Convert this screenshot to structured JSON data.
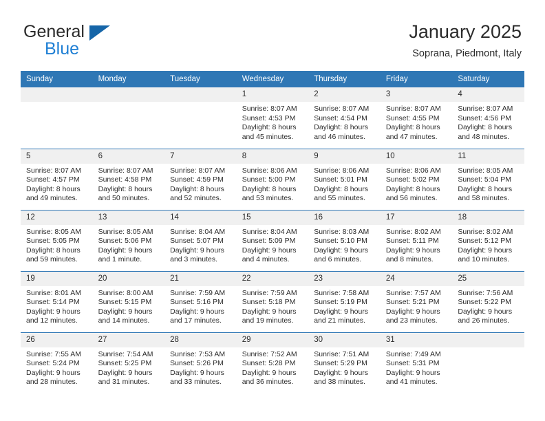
{
  "brand": {
    "word_one": "General",
    "word_two": "Blue",
    "logo_icon": "triangle-logo-icon"
  },
  "header": {
    "title": "January 2025",
    "subtitle": "Soprana, Piedmont, Italy"
  },
  "colors": {
    "header_blue": "#2f77b5",
    "brand_blue": "#1f7fd4",
    "daynum_band": "#f0f0f0",
    "text": "#2b2b2b"
  },
  "weekday_headers": [
    "Sunday",
    "Monday",
    "Tuesday",
    "Wednesday",
    "Thursday",
    "Friday",
    "Saturday"
  ],
  "weeks": [
    [
      {
        "day": "",
        "empty": true,
        "sunrise": "",
        "sunset": "",
        "daylight_line1": "",
        "daylight_line2": ""
      },
      {
        "day": "",
        "empty": true,
        "sunrise": "",
        "sunset": "",
        "daylight_line1": "",
        "daylight_line2": ""
      },
      {
        "day": "",
        "empty": true,
        "sunrise": "",
        "sunset": "",
        "daylight_line1": "",
        "daylight_line2": ""
      },
      {
        "day": "1",
        "empty": false,
        "sunrise": "Sunrise: 8:07 AM",
        "sunset": "Sunset: 4:53 PM",
        "daylight_line1": "Daylight: 8 hours",
        "daylight_line2": "and 45 minutes."
      },
      {
        "day": "2",
        "empty": false,
        "sunrise": "Sunrise: 8:07 AM",
        "sunset": "Sunset: 4:54 PM",
        "daylight_line1": "Daylight: 8 hours",
        "daylight_line2": "and 46 minutes."
      },
      {
        "day": "3",
        "empty": false,
        "sunrise": "Sunrise: 8:07 AM",
        "sunset": "Sunset: 4:55 PM",
        "daylight_line1": "Daylight: 8 hours",
        "daylight_line2": "and 47 minutes."
      },
      {
        "day": "4",
        "empty": false,
        "sunrise": "Sunrise: 8:07 AM",
        "sunset": "Sunset: 4:56 PM",
        "daylight_line1": "Daylight: 8 hours",
        "daylight_line2": "and 48 minutes."
      }
    ],
    [
      {
        "day": "5",
        "empty": false,
        "sunrise": "Sunrise: 8:07 AM",
        "sunset": "Sunset: 4:57 PM",
        "daylight_line1": "Daylight: 8 hours",
        "daylight_line2": "and 49 minutes."
      },
      {
        "day": "6",
        "empty": false,
        "sunrise": "Sunrise: 8:07 AM",
        "sunset": "Sunset: 4:58 PM",
        "daylight_line1": "Daylight: 8 hours",
        "daylight_line2": "and 50 minutes."
      },
      {
        "day": "7",
        "empty": false,
        "sunrise": "Sunrise: 8:07 AM",
        "sunset": "Sunset: 4:59 PM",
        "daylight_line1": "Daylight: 8 hours",
        "daylight_line2": "and 52 minutes."
      },
      {
        "day": "8",
        "empty": false,
        "sunrise": "Sunrise: 8:06 AM",
        "sunset": "Sunset: 5:00 PM",
        "daylight_line1": "Daylight: 8 hours",
        "daylight_line2": "and 53 minutes."
      },
      {
        "day": "9",
        "empty": false,
        "sunrise": "Sunrise: 8:06 AM",
        "sunset": "Sunset: 5:01 PM",
        "daylight_line1": "Daylight: 8 hours",
        "daylight_line2": "and 55 minutes."
      },
      {
        "day": "10",
        "empty": false,
        "sunrise": "Sunrise: 8:06 AM",
        "sunset": "Sunset: 5:02 PM",
        "daylight_line1": "Daylight: 8 hours",
        "daylight_line2": "and 56 minutes."
      },
      {
        "day": "11",
        "empty": false,
        "sunrise": "Sunrise: 8:05 AM",
        "sunset": "Sunset: 5:04 PM",
        "daylight_line1": "Daylight: 8 hours",
        "daylight_line2": "and 58 minutes."
      }
    ],
    [
      {
        "day": "12",
        "empty": false,
        "sunrise": "Sunrise: 8:05 AM",
        "sunset": "Sunset: 5:05 PM",
        "daylight_line1": "Daylight: 8 hours",
        "daylight_line2": "and 59 minutes."
      },
      {
        "day": "13",
        "empty": false,
        "sunrise": "Sunrise: 8:05 AM",
        "sunset": "Sunset: 5:06 PM",
        "daylight_line1": "Daylight: 9 hours",
        "daylight_line2": "and 1 minute."
      },
      {
        "day": "14",
        "empty": false,
        "sunrise": "Sunrise: 8:04 AM",
        "sunset": "Sunset: 5:07 PM",
        "daylight_line1": "Daylight: 9 hours",
        "daylight_line2": "and 3 minutes."
      },
      {
        "day": "15",
        "empty": false,
        "sunrise": "Sunrise: 8:04 AM",
        "sunset": "Sunset: 5:09 PM",
        "daylight_line1": "Daylight: 9 hours",
        "daylight_line2": "and 4 minutes."
      },
      {
        "day": "16",
        "empty": false,
        "sunrise": "Sunrise: 8:03 AM",
        "sunset": "Sunset: 5:10 PM",
        "daylight_line1": "Daylight: 9 hours",
        "daylight_line2": "and 6 minutes."
      },
      {
        "day": "17",
        "empty": false,
        "sunrise": "Sunrise: 8:02 AM",
        "sunset": "Sunset: 5:11 PM",
        "daylight_line1": "Daylight: 9 hours",
        "daylight_line2": "and 8 minutes."
      },
      {
        "day": "18",
        "empty": false,
        "sunrise": "Sunrise: 8:02 AM",
        "sunset": "Sunset: 5:12 PM",
        "daylight_line1": "Daylight: 9 hours",
        "daylight_line2": "and 10 minutes."
      }
    ],
    [
      {
        "day": "19",
        "empty": false,
        "sunrise": "Sunrise: 8:01 AM",
        "sunset": "Sunset: 5:14 PM",
        "daylight_line1": "Daylight: 9 hours",
        "daylight_line2": "and 12 minutes."
      },
      {
        "day": "20",
        "empty": false,
        "sunrise": "Sunrise: 8:00 AM",
        "sunset": "Sunset: 5:15 PM",
        "daylight_line1": "Daylight: 9 hours",
        "daylight_line2": "and 14 minutes."
      },
      {
        "day": "21",
        "empty": false,
        "sunrise": "Sunrise: 7:59 AM",
        "sunset": "Sunset: 5:16 PM",
        "daylight_line1": "Daylight: 9 hours",
        "daylight_line2": "and 17 minutes."
      },
      {
        "day": "22",
        "empty": false,
        "sunrise": "Sunrise: 7:59 AM",
        "sunset": "Sunset: 5:18 PM",
        "daylight_line1": "Daylight: 9 hours",
        "daylight_line2": "and 19 minutes."
      },
      {
        "day": "23",
        "empty": false,
        "sunrise": "Sunrise: 7:58 AM",
        "sunset": "Sunset: 5:19 PM",
        "daylight_line1": "Daylight: 9 hours",
        "daylight_line2": "and 21 minutes."
      },
      {
        "day": "24",
        "empty": false,
        "sunrise": "Sunrise: 7:57 AM",
        "sunset": "Sunset: 5:21 PM",
        "daylight_line1": "Daylight: 9 hours",
        "daylight_line2": "and 23 minutes."
      },
      {
        "day": "25",
        "empty": false,
        "sunrise": "Sunrise: 7:56 AM",
        "sunset": "Sunset: 5:22 PM",
        "daylight_line1": "Daylight: 9 hours",
        "daylight_line2": "and 26 minutes."
      }
    ],
    [
      {
        "day": "26",
        "empty": false,
        "sunrise": "Sunrise: 7:55 AM",
        "sunset": "Sunset: 5:24 PM",
        "daylight_line1": "Daylight: 9 hours",
        "daylight_line2": "and 28 minutes."
      },
      {
        "day": "27",
        "empty": false,
        "sunrise": "Sunrise: 7:54 AM",
        "sunset": "Sunset: 5:25 PM",
        "daylight_line1": "Daylight: 9 hours",
        "daylight_line2": "and 31 minutes."
      },
      {
        "day": "28",
        "empty": false,
        "sunrise": "Sunrise: 7:53 AM",
        "sunset": "Sunset: 5:26 PM",
        "daylight_line1": "Daylight: 9 hours",
        "daylight_line2": "and 33 minutes."
      },
      {
        "day": "29",
        "empty": false,
        "sunrise": "Sunrise: 7:52 AM",
        "sunset": "Sunset: 5:28 PM",
        "daylight_line1": "Daylight: 9 hours",
        "daylight_line2": "and 36 minutes."
      },
      {
        "day": "30",
        "empty": false,
        "sunrise": "Sunrise: 7:51 AM",
        "sunset": "Sunset: 5:29 PM",
        "daylight_line1": "Daylight: 9 hours",
        "daylight_line2": "and 38 minutes."
      },
      {
        "day": "31",
        "empty": false,
        "sunrise": "Sunrise: 7:49 AM",
        "sunset": "Sunset: 5:31 PM",
        "daylight_line1": "Daylight: 9 hours",
        "daylight_line2": "and 41 minutes."
      },
      {
        "day": "",
        "empty": true,
        "sunrise": "",
        "sunset": "",
        "daylight_line1": "",
        "daylight_line2": ""
      }
    ]
  ]
}
